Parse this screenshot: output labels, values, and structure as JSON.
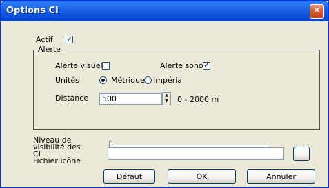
{
  "window": {
    "title": "Options CI",
    "close_glyph": "✕"
  },
  "actif": {
    "label": "Actif",
    "checked": true,
    "mark": "✓"
  },
  "alerte": {
    "legend": "Alerte",
    "visuelle": {
      "label": "Alerte visuelle",
      "checked": false,
      "mark": ""
    },
    "sonore": {
      "label": "Alerte sonore",
      "checked": true,
      "mark": "✓"
    },
    "unites": {
      "label": "Unités",
      "options": [
        "Métrique",
        "Impérial"
      ],
      "selected": "Métrique"
    },
    "distance": {
      "label": "Distance",
      "value": "500",
      "range_text": "0 - 2000 m"
    }
  },
  "visibilite": {
    "label": "Niveau de visibilité des CI",
    "label_lines": [
      "Niveau de",
      "visibilité des",
      "CI"
    ],
    "slider_value": 0
  },
  "fichier": {
    "label": "Fichier icône",
    "value": "",
    "browse_label": ""
  },
  "buttons": {
    "defaut": "Défaut",
    "ok": "OK",
    "annuler": "Annuler"
  },
  "colors": {
    "titlebar": "#0a5ef0",
    "dialog_bg": "#ece9d8",
    "close_button": "#d65b35"
  }
}
